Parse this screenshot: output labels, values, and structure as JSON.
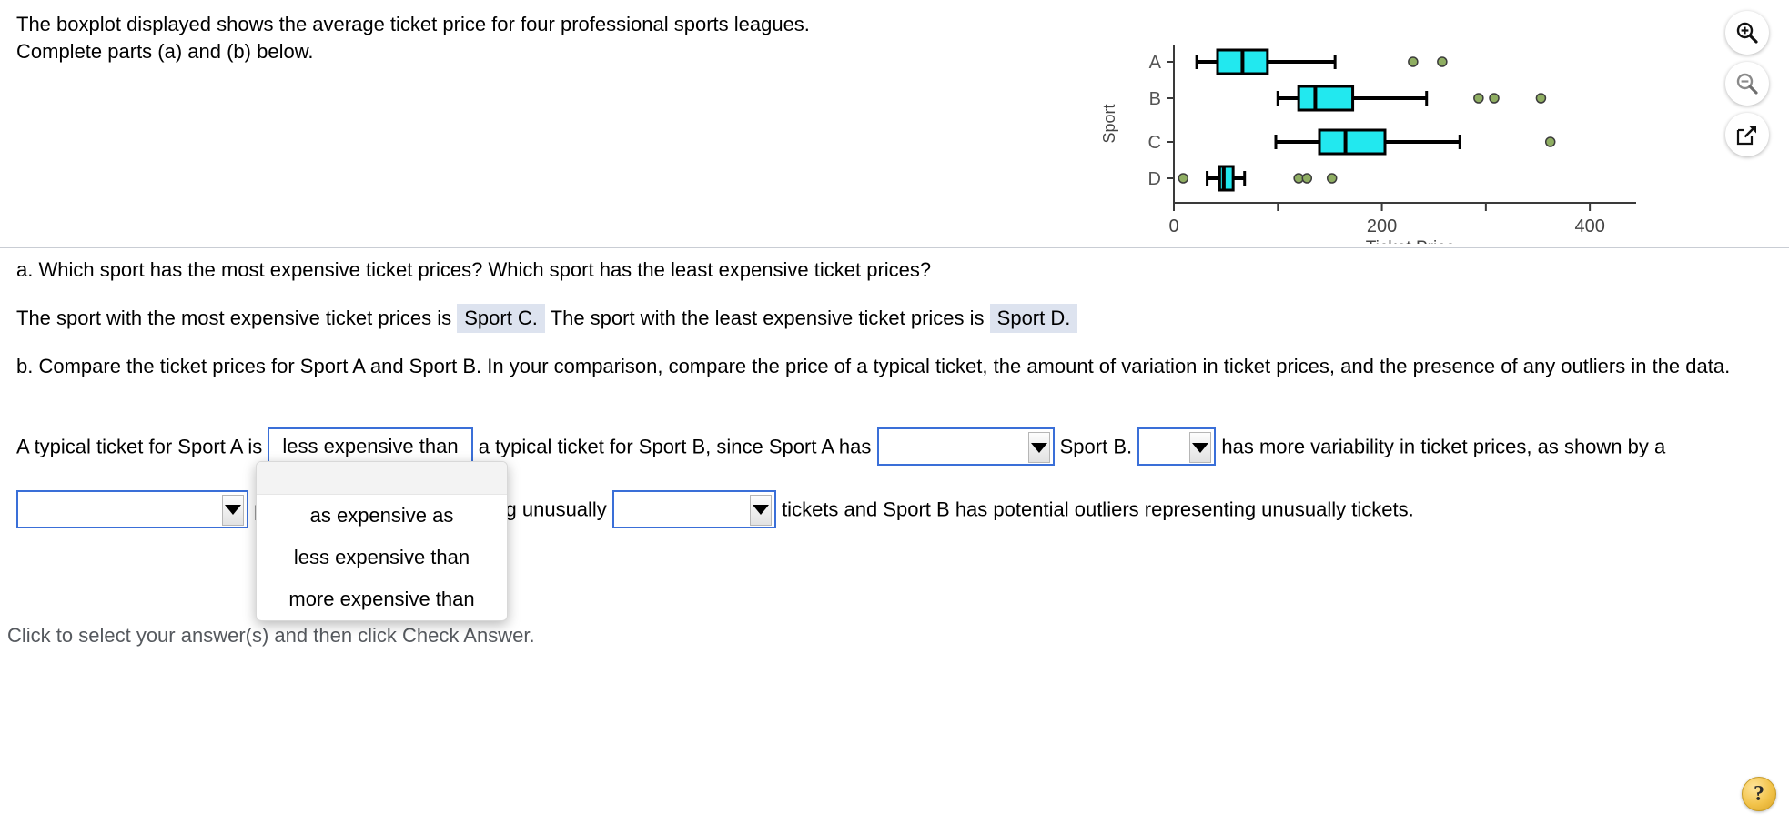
{
  "problem": {
    "statement": "The boxplot displayed shows the average ticket price for four professional sports leagues. Complete parts (a) and (b) below."
  },
  "toolbar": {
    "zoom_in": "zoom-in-icon",
    "zoom_out": "zoom-out-icon",
    "popout": "popout-icon"
  },
  "part_a": {
    "question": "a. Which sport has the most expensive ticket prices? Which sport has the least expensive ticket prices?",
    "answer_prefix": "The sport with the most expensive ticket prices is",
    "most_expensive": "Sport C.",
    "answer_middle": "The sport with the least expensive ticket prices is",
    "least_expensive": "Sport D."
  },
  "part_b": {
    "question": "b. Compare the ticket prices for Sport A and Sport B. In your comparison, compare the price of a typical ticket, the amount of variation in ticket prices, and the presence of any outliers in the data.",
    "seg1": "A typical ticket for Sport A is",
    "selected_comparison": "less expensive than",
    "seg2": "a typical ticket for Sport B, since Sport A has",
    "select_compare_b_value": "",
    "seg3": "Sport B.",
    "select_variability_value": "",
    "seg4": "has more variability in",
    "seg5": "ticket prices, as shown by a",
    "select_outliers_a_value": "",
    "seg6": "potential outliers representing unusually",
    "select_outliers_b_value": "",
    "seg7": "tickets and Sport B has potential",
    "seg8": "outliers representing unusually",
    "seg9": "tickets."
  },
  "dropdown": {
    "open": true,
    "blank_option": "",
    "options": [
      "as expensive as",
      "less expensive than",
      "more expensive than"
    ]
  },
  "footer": {
    "hint": "Click to select your answer(s) and then click Check Answer.",
    "help_label": "?"
  },
  "chart_data": {
    "type": "boxplot",
    "title": "",
    "xlabel": "Ticket Price",
    "ylabel": "Sport",
    "categories": [
      "A",
      "B",
      "C",
      "D"
    ],
    "xlim": [
      0,
      420
    ],
    "xticks": [
      0,
      100,
      200,
      300,
      400
    ],
    "xtick_labels": [
      "0",
      "",
      "200",
      "",
      "400"
    ],
    "grid": false,
    "box_fill_color": "#22e8ef",
    "outlier_color": "#8fae62",
    "line_color": "#000000",
    "boxes": [
      {
        "category": "A",
        "whisker_low": 22,
        "q1": 42,
        "median": 66,
        "q3": 90,
        "whisker_high": 155,
        "outliers": [
          230,
          258
        ]
      },
      {
        "category": "B",
        "whisker_low": 100,
        "q1": 120,
        "median": 136,
        "q3": 172,
        "whisker_high": 243,
        "outliers": [
          293,
          308,
          353
        ]
      },
      {
        "category": "C",
        "whisker_low": 98,
        "q1": 140,
        "median": 165,
        "q3": 203,
        "whisker_high": 275,
        "outliers": [
          362
        ]
      },
      {
        "category": "D",
        "whisker_low": 32,
        "q1": 44,
        "median": 48,
        "q3": 57,
        "whisker_high": 68,
        "outliers": [
          9,
          120,
          128,
          152
        ]
      }
    ]
  }
}
